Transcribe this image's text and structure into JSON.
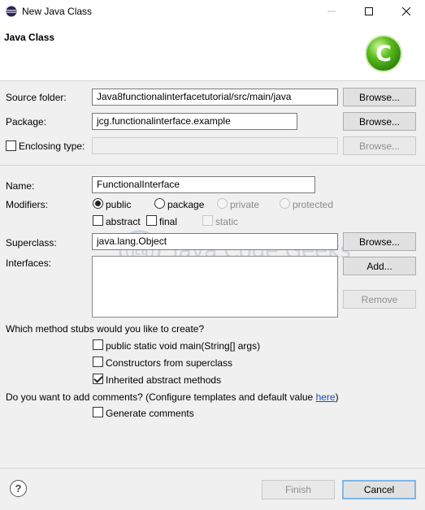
{
  "window": {
    "title": "New Java Class"
  },
  "banner": {
    "title": "Java Class",
    "logo_letter": "C"
  },
  "source_folder": {
    "label": "Source folder:",
    "value": "Java8functionalinterfacetutorial/src/main/java",
    "browse_label": "Browse..."
  },
  "package": {
    "label": "Package:",
    "value": "jcg.functionalinterface.example",
    "browse_label": "Browse..."
  },
  "enclosing_type": {
    "label": "Enclosing type:",
    "value": "",
    "checked": false,
    "browse_label": "Browse..."
  },
  "name": {
    "label": "Name:",
    "value": "FunctionalInterface"
  },
  "modifiers": {
    "label": "Modifiers:",
    "access": [
      {
        "label": "public",
        "selected": true,
        "enabled": true
      },
      {
        "label": "package",
        "selected": false,
        "enabled": true
      },
      {
        "label": "private",
        "selected": false,
        "enabled": false
      },
      {
        "label": "protected",
        "selected": false,
        "enabled": false
      }
    ],
    "flags": [
      {
        "label": "abstract",
        "checked": false,
        "enabled": true
      },
      {
        "label": "final",
        "checked": false,
        "enabled": true
      },
      {
        "label": "static",
        "checked": false,
        "enabled": false
      }
    ]
  },
  "superclass": {
    "label": "Superclass:",
    "value": "java.lang.Object",
    "browse_label": "Browse..."
  },
  "interfaces": {
    "label": "Interfaces:",
    "add_label": "Add...",
    "remove_label": "Remove"
  },
  "watermark": {
    "name": "Java Code Geeks",
    "tagline": "JAVA 2 JAVA DEVELOPERS RESOURCE CENTER",
    "logo_text": "jcg"
  },
  "method_stubs": {
    "question": "Which method stubs would you like to create?",
    "options": [
      {
        "label": "public static void main(String[] args)",
        "checked": false
      },
      {
        "label": "Constructors from superclass",
        "checked": false
      },
      {
        "label": "Inherited abstract methods",
        "checked": true
      }
    ]
  },
  "comments": {
    "question": "Do you want to add comments? (Configure templates and default value ",
    "link": "here",
    "question_end": ")",
    "option": {
      "label": "Generate comments",
      "checked": false
    }
  },
  "footer": {
    "finish_label": "Finish",
    "cancel_label": "Cancel"
  },
  "colors": {
    "logo_green": "#5cbf1e",
    "link_blue": "#0b51c5",
    "focus_border": "#7cb7e8"
  }
}
